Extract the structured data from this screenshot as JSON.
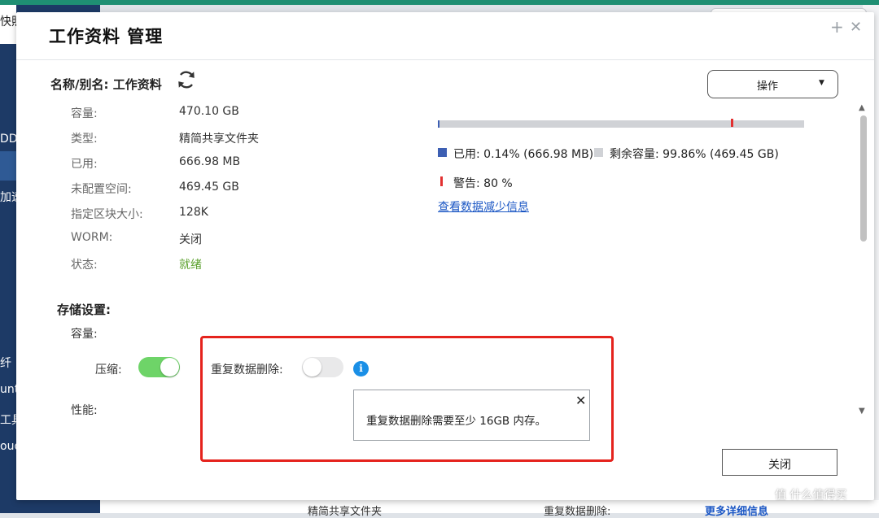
{
  "background": {
    "left_fragments": [
      "快照",
      "DD",
      "加速",
      "纤",
      "unt",
      "工具",
      "oud"
    ],
    "bottom_fragments": [
      "精简共享文件夹",
      "重复数据删除:"
    ],
    "bottom_link": "更多详细信息"
  },
  "modal": {
    "title": "工作资料  管理",
    "add_icon": "+",
    "close_icon": "✕",
    "name_label": "名称/别名:",
    "name_value": "工作资料",
    "info": [
      {
        "label": "容量:",
        "value": "470.10 GB"
      },
      {
        "label": "类型:",
        "value": "精简共享文件夹"
      },
      {
        "label": "已用:",
        "value": "666.98 MB"
      },
      {
        "label": "未配置空间:",
        "value": "469.45 GB"
      },
      {
        "label": "指定区块大小:",
        "value": "128K"
      },
      {
        "label": "WORM:",
        "value": "关闭"
      },
      {
        "label": "状态:",
        "value": "就绪"
      }
    ],
    "action_button": "操作",
    "usage": {
      "used_fraction": 0.0014,
      "warning_fraction": 0.8,
      "used_color": "#3d5fb3",
      "free_color": "#d0d2d6",
      "warning_color": "#e23030"
    },
    "legend_used": "已用: 0.14% (666.98 MB)",
    "legend_free": "剩余容量: 99.86% (469.45 GB)",
    "legend_warning": "警告: 80 %",
    "dedup_link": "查看数据减少信息",
    "storage": {
      "title": "存储设置:",
      "capacity_label": "容量:",
      "compression_label": "压缩:",
      "compression_on": true,
      "performance_label": "性能:",
      "dedup_label": "重复数据删除:",
      "dedup_on": false
    },
    "tooltip": {
      "text": "重复数据删除需要至少 16GB 内存。",
      "close": "✕"
    },
    "close_button": "关闭"
  },
  "watermark": "值 什么值得买"
}
